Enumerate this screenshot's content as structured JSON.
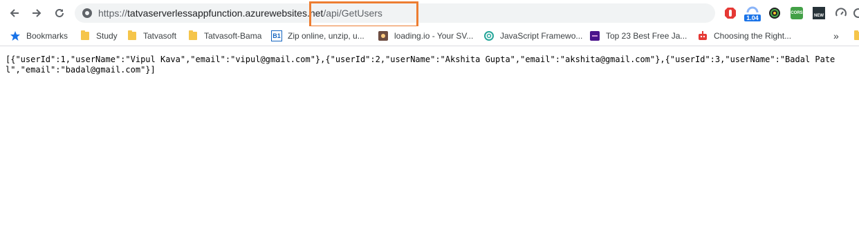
{
  "url": {
    "scheme": "https://",
    "host": "tatvaserverlessappfunction.azurewebsites.net",
    "path": "/api/GetUsers"
  },
  "bookmarks": [
    {
      "label": "Bookmarks",
      "icon": "star-icon"
    },
    {
      "label": "Study",
      "icon": "folder-icon"
    },
    {
      "label": "Tatvasoft",
      "icon": "folder-icon"
    },
    {
      "label": "Tatvasoft-Bama",
      "icon": "folder-icon"
    },
    {
      "label": "Zip online, unzip, u...",
      "icon": "b1-icon"
    },
    {
      "label": "loading.io - Your SV...",
      "icon": "loading-io-icon"
    },
    {
      "label": "JavaScript Framewo...",
      "icon": "spiral-icon"
    },
    {
      "label": "Top 23 Best Free Ja...",
      "icon": "colorlib-icon"
    },
    {
      "label": "Choosing the Right...",
      "icon": "robot-icon"
    }
  ],
  "bookmarks_overflow": "»",
  "extensions": {
    "badge_version": "1.04",
    "cors_label": "CORS",
    "new_label": "NEW"
  },
  "json_output": "[{\"userId\":1,\"userName\":\"Vipul Kava\",\"email\":\"vipul@gmail.com\"},{\"userId\":2,\"userName\":\"Akshita Gupta\",\"email\":\"akshita@gmail.com\"},{\"userId\":3,\"userName\":\"Badal Patel\",\"email\":\"badal@gmail.com\"}]",
  "colors": {
    "highlight": "#ed7d31",
    "omnibox_bg": "#f1f3f4",
    "folder": "#f5c54a",
    "star": "#1a73e8"
  }
}
